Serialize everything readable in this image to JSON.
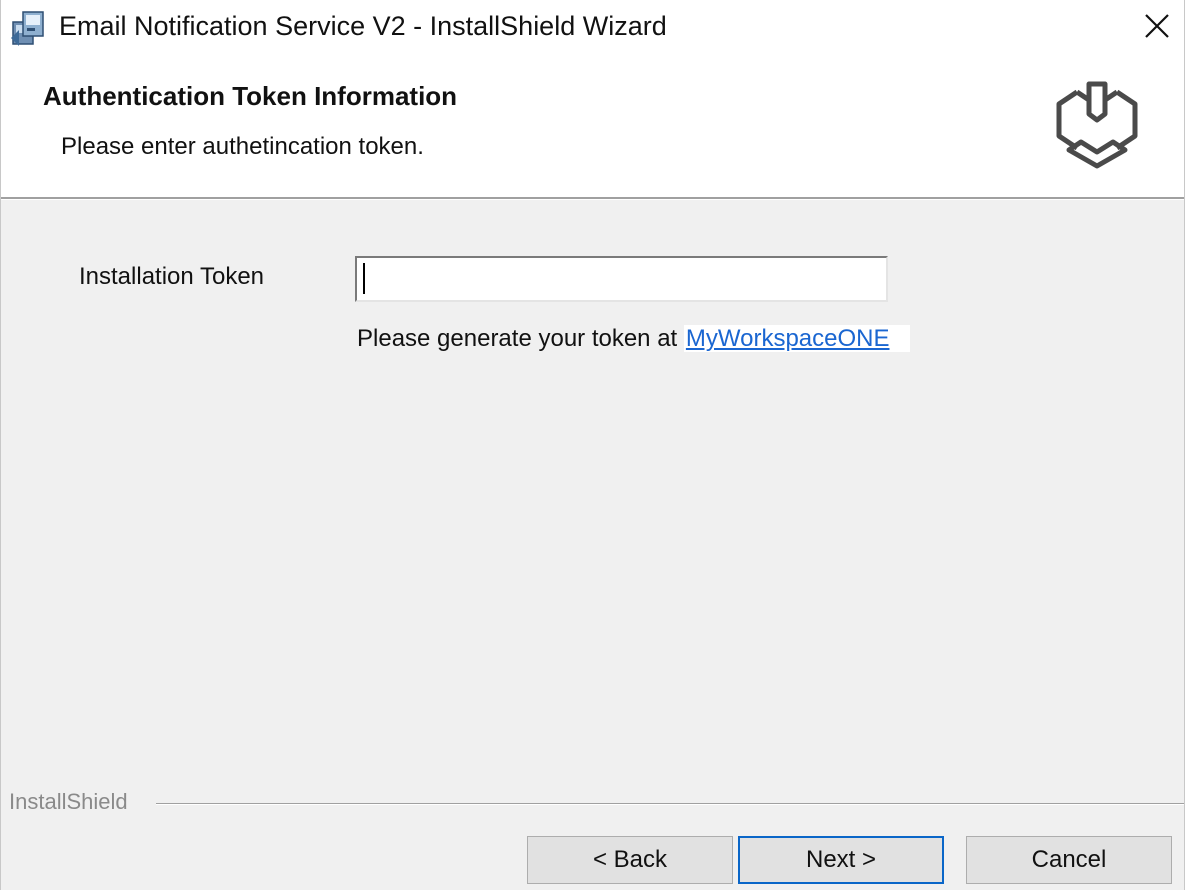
{
  "window": {
    "title": "Email Notification Service V2 - InstallShield Wizard",
    "app_icon": "installer-icon",
    "close_icon": "close-icon"
  },
  "banner": {
    "title": "Authentication Token Information",
    "subtitle": "Please enter authetincation token.",
    "logo_icon": "workspace-one-logo-icon"
  },
  "form": {
    "token_label": "Installation Token",
    "token_value": "",
    "token_placeholder": "",
    "hint_text": "Please generate your token at ",
    "hint_link": "MyWorkspaceONE"
  },
  "footer": {
    "brand": "InstallShield",
    "back_label": "< Back",
    "next_label": "Next >",
    "cancel_label": "Cancel"
  },
  "colors": {
    "link": "#1a66d1",
    "default_button_border": "#0a66c8",
    "dialog_background": "#f0f0f0",
    "banner_background": "#ffffff"
  }
}
